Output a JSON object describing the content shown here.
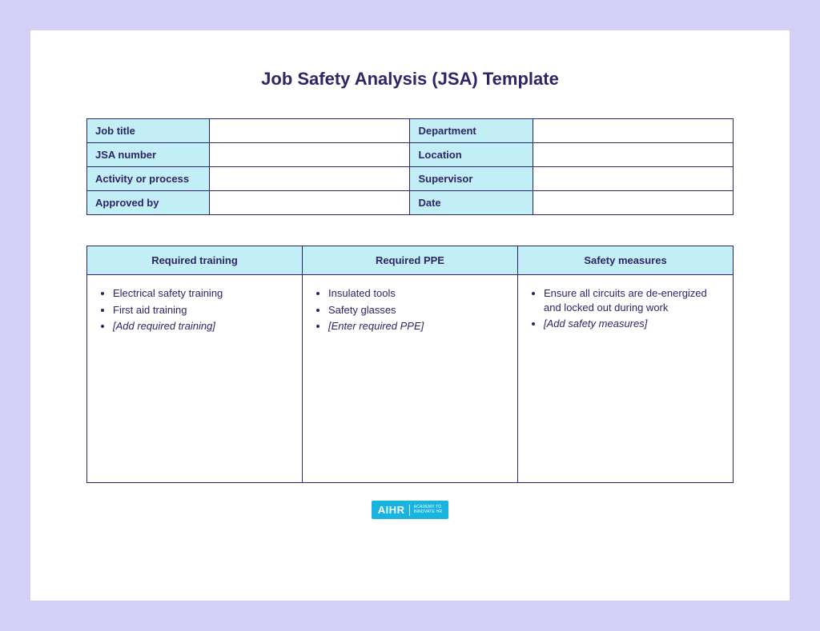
{
  "title": "Job Safety Analysis (JSA) Template",
  "info": {
    "rows": [
      {
        "left_label": "Job title",
        "left_value": "",
        "right_label": "Department",
        "right_value": ""
      },
      {
        "left_label": "JSA number",
        "left_value": "",
        "right_label": "Location",
        "right_value": ""
      },
      {
        "left_label": "Activity or process",
        "left_value": "",
        "right_label": "Supervisor",
        "right_value": ""
      },
      {
        "left_label": "Approved by",
        "left_value": "",
        "right_label": "Date",
        "right_value": ""
      }
    ]
  },
  "requirements": {
    "headers": [
      "Required training",
      "Required PPE",
      "Safety measures"
    ],
    "columns": [
      [
        {
          "text": "Electrical safety training",
          "italic": false
        },
        {
          "text": "First aid training",
          "italic": false
        },
        {
          "text": "[Add required training]",
          "italic": true
        }
      ],
      [
        {
          "text": "Insulated tools",
          "italic": false
        },
        {
          "text": "Safety glasses",
          "italic": false
        },
        {
          "text": "[Enter required PPE]",
          "italic": true
        }
      ],
      [
        {
          "text": "Ensure all circuits are de-energized and locked out during work",
          "italic": false
        },
        {
          "text": "[Add safety measures]",
          "italic": true
        }
      ]
    ]
  },
  "logo": {
    "main": "AIHR",
    "sub_line1": "ACADEMY TO",
    "sub_line2": "INNOVATE HR"
  }
}
